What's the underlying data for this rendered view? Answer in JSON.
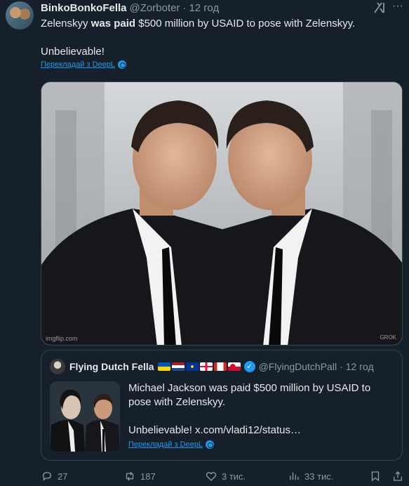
{
  "tweet": {
    "author_name": "BinkoBonkoFella",
    "author_handle": "@Zorboter",
    "separator": "·",
    "time": "12 год",
    "text_part1": "Zelenskyy ",
    "text_bold": "was paid",
    "text_part2": " $500 million by USAID to pose with Zelenskyy.",
    "text_line2": "Unbelievable!",
    "translate_label": "Перекладай з DeepL",
    "media_watermark_left": "imgflip.com",
    "media_watermark_right": "GROK"
  },
  "quote": {
    "author_name": "Flying Dutch Fella",
    "author_handle": "@FlyingDutchPall",
    "separator": "·",
    "time": "12 год",
    "text": "Michael Jackson was paid $500 million by USAID to pose with Zelenskyy.",
    "text_line2": "Unbelievable!  x.com/vladi12/status…",
    "translate_label": "Перекладай з DeepL",
    "flags": [
      "ukraine",
      "netherlands",
      "eu",
      "georgia",
      "canada",
      "greenland"
    ]
  },
  "actions": {
    "replies": "27",
    "retweets": "187",
    "likes": "3 тис.",
    "views": "33 тис."
  },
  "colors": {
    "background": "#15202b",
    "text": "#e7e9ea",
    "muted": "#8b98a5",
    "accent": "#1d9bf0",
    "border": "#38444d"
  },
  "icons": [
    "grok-icon",
    "more-icon",
    "deepl-icon",
    "verified-icon",
    "reply-icon",
    "retweet-icon",
    "like-icon",
    "views-icon",
    "bookmark-icon",
    "share-icon"
  ]
}
